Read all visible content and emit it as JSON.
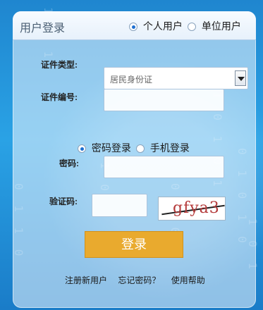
{
  "login": {
    "title": "用户登录",
    "user_type_personal": "个人用户",
    "user_type_org": "单位用户",
    "id_type_label": "证件类型:",
    "id_type_value": "居民身份证",
    "id_number_label": "证件编号:",
    "mode_password": "密码登录",
    "mode_phone": "手机登录",
    "password_label": "密码:",
    "captcha_label": "验证码:",
    "captcha_text": "gfya3",
    "submit_label": "登录",
    "links": [
      "注册新用户",
      "忘记密码？",
      "使用帮助"
    ]
  }
}
